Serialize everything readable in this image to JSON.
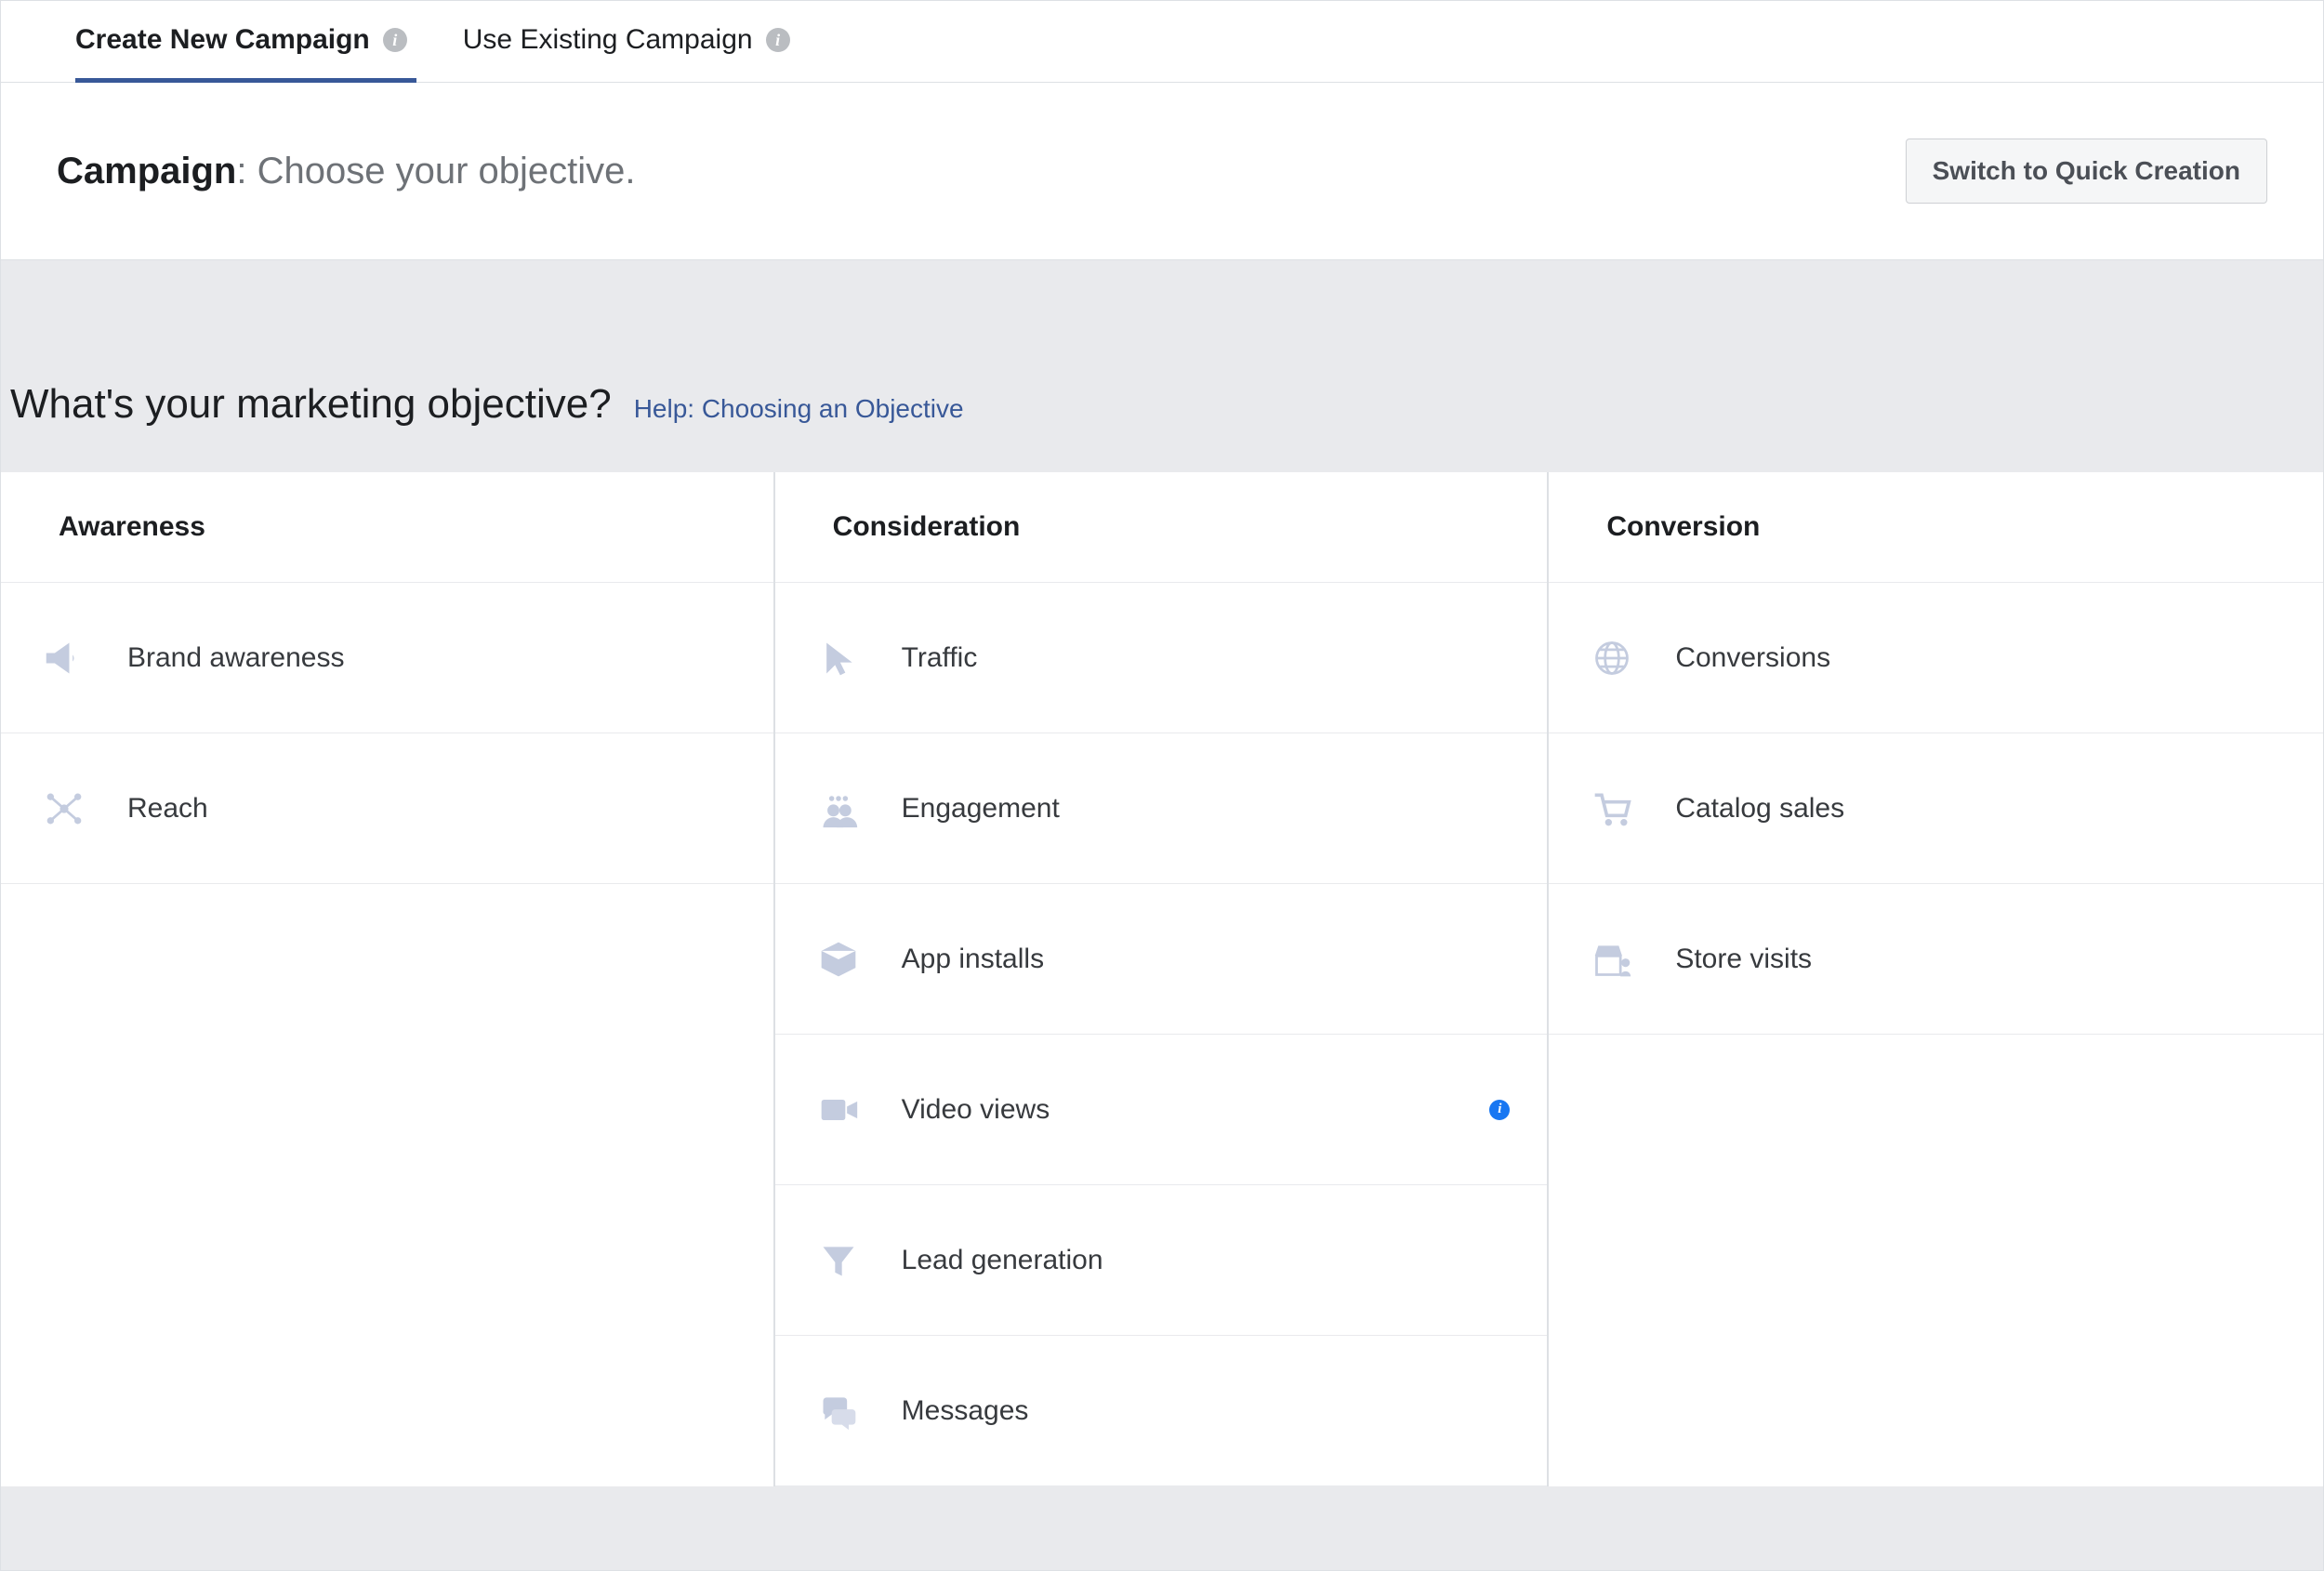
{
  "tabs": {
    "create_new": "Create New Campaign",
    "use_existing": "Use Existing Campaign"
  },
  "header": {
    "title_strong": "Campaign",
    "title_rest": ": Choose your objective.",
    "switch_button": "Switch to Quick Creation"
  },
  "question": {
    "text": "What's your marketing objective?",
    "help_text": "Help: Choosing an Objective"
  },
  "columns": {
    "awareness": {
      "label": "Awareness",
      "items": [
        {
          "label": "Brand awareness",
          "icon": "megaphone-icon"
        },
        {
          "label": "Reach",
          "icon": "network-icon"
        }
      ]
    },
    "consideration": {
      "label": "Consideration",
      "items": [
        {
          "label": "Traffic",
          "icon": "cursor-icon"
        },
        {
          "label": "Engagement",
          "icon": "people-icon"
        },
        {
          "label": "App installs",
          "icon": "box-icon"
        },
        {
          "label": "Video views",
          "icon": "video-icon",
          "info": true
        },
        {
          "label": "Lead generation",
          "icon": "funnel-icon"
        },
        {
          "label": "Messages",
          "icon": "chat-icon"
        }
      ]
    },
    "conversion": {
      "label": "Conversion",
      "items": [
        {
          "label": "Conversions",
          "icon": "globe-icon"
        },
        {
          "label": "Catalog sales",
          "icon": "cart-icon"
        },
        {
          "label": "Store visits",
          "icon": "store-icon"
        }
      ]
    }
  }
}
